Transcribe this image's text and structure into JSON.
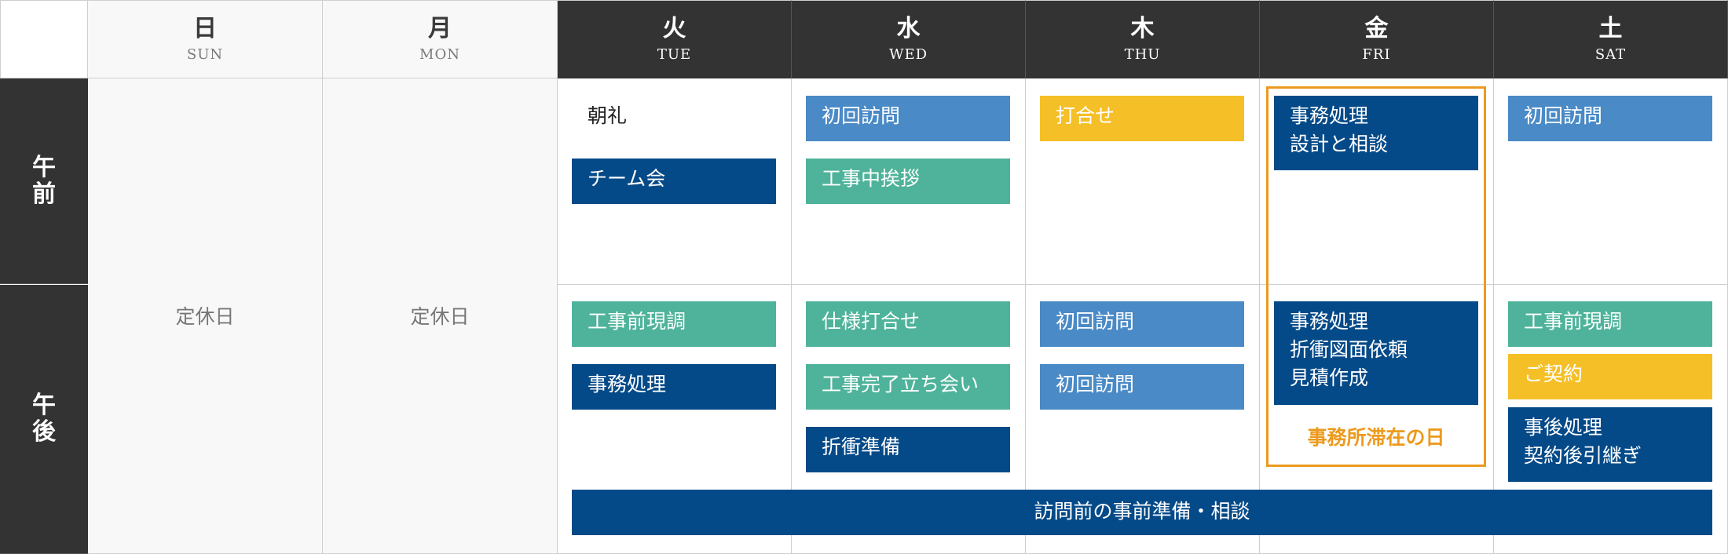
{
  "days": [
    {
      "kanji": "日",
      "eng": "SUN"
    },
    {
      "kanji": "月",
      "eng": "MON"
    },
    {
      "kanji": "火",
      "eng": "TUE"
    },
    {
      "kanji": "水",
      "eng": "WED"
    },
    {
      "kanji": "木",
      "eng": "THU"
    },
    {
      "kanji": "金",
      "eng": "FRI"
    },
    {
      "kanji": "土",
      "eng": "SAT"
    }
  ],
  "periods": {
    "am": [
      "午",
      "前"
    ],
    "pm": [
      "午",
      "後"
    ]
  },
  "closed_label": "定休日",
  "events": {
    "tue_am": [
      "朝礼",
      "チーム会"
    ],
    "tue_pm": [
      "工事前現調",
      "事務処理"
    ],
    "wed_am": [
      "初回訪問",
      "工事中挨拶"
    ],
    "wed_pm": [
      "仕様打合せ",
      "工事完了立ち会い",
      "折衝準備"
    ],
    "thu_am": [
      "打合せ"
    ],
    "thu_pm": [
      "初回訪問",
      "初回訪問"
    ],
    "fri_am": [
      "事務処理\n設計と相談"
    ],
    "fri_pm": [
      "事務処理\n折衝図面依頼\n見積作成"
    ],
    "sat_am": [
      "初回訪問"
    ],
    "sat_pm": [
      "工事前現調",
      "ご契約",
      "事後処理\n契約後引継ぎ"
    ]
  },
  "fri_highlight_label": "事務所滞在の日",
  "shared_event": "訪問前の事前準備・相談",
  "colors": {
    "navy": "#054a88",
    "blue": "#4a8ac6",
    "green": "#4eb39a",
    "yellow": "#f5bf27",
    "orange": "#ec9a1e",
    "dark": "#333333"
  }
}
